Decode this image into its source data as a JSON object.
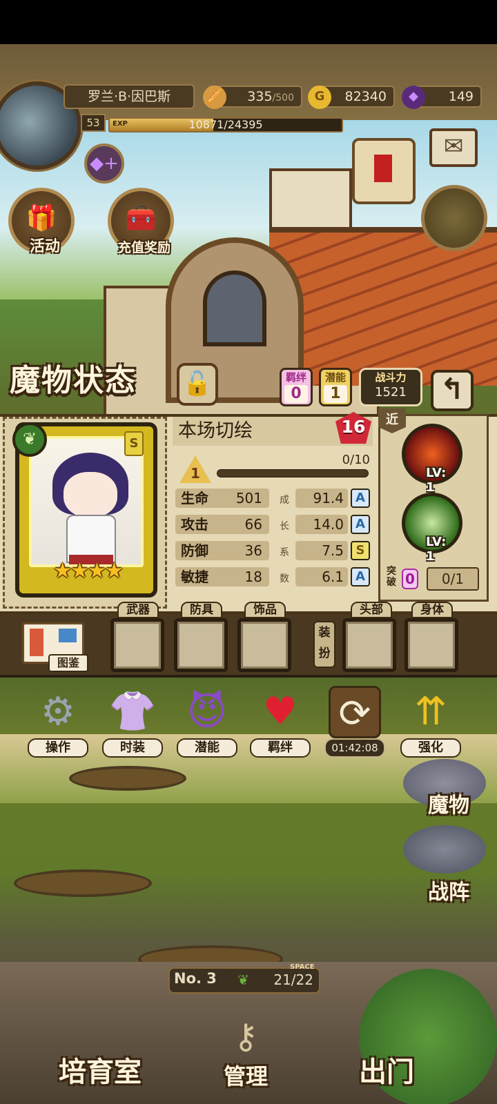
{
  "player": {
    "name": "罗兰·B·因巴斯",
    "level": "53",
    "exp_tag": "EXP",
    "exp_text": "10871/24395",
    "exp_fraction": 0.4456
  },
  "resources": {
    "stamina_value": "335",
    "stamina_max": "/500",
    "gold": "82340",
    "gems": "149"
  },
  "menu": {
    "events_label": "活动",
    "recharge_label": "充值奖励"
  },
  "status": {
    "title": "魔物状态",
    "bond_caption": "羁绊",
    "bond_value": "0",
    "potential_caption": "潜能",
    "potential_value": "1",
    "power_caption": "战斗力",
    "power_value": "1521"
  },
  "monster": {
    "name": "本场切绘",
    "level": "16",
    "rank": "S",
    "stars": "★★★★",
    "awaken_level": "1",
    "awaken_progress": "0/10",
    "awaken_fraction": 0,
    "range": "近",
    "stats": [
      {
        "name": "生命",
        "value": "501",
        "growth": "91.4",
        "grade": "A"
      },
      {
        "name": "攻击",
        "value": "66",
        "growth": "14.0",
        "grade": "A"
      },
      {
        "name": "防御",
        "value": "36",
        "growth": "7.5",
        "grade": "S"
      },
      {
        "name": "敏捷",
        "value": "18",
        "growth": "6.1",
        "grade": "A"
      }
    ],
    "growth_chars": [
      "成",
      "长",
      "系",
      "数"
    ],
    "skills": [
      {
        "level": "LV: 1"
      },
      {
        "level": "LV: 1"
      }
    ],
    "breakthrough_label": "突破",
    "breakthrough_count": "0",
    "breakthrough_progress": "0/1"
  },
  "equipment": {
    "codex_label": "图鉴",
    "weapon_label": "武器",
    "armor_label": "防具",
    "accessory_label": "饰品",
    "dressup_label": "装扮",
    "head_label": "头部",
    "body_label": "身体"
  },
  "actions": {
    "operate": "操作",
    "fashion": "时装",
    "potential": "潜能",
    "bond": "羁绊",
    "timer": "01:42:08",
    "enhance": "强化"
  },
  "side": {
    "monster": "魔物",
    "formation": "战阵"
  },
  "room": {
    "number": "No. 3",
    "capacity": "21/22",
    "space_tag": "SPACE"
  },
  "nav": {
    "nursery": "培育室",
    "manage": "管理",
    "exit": "出门"
  }
}
